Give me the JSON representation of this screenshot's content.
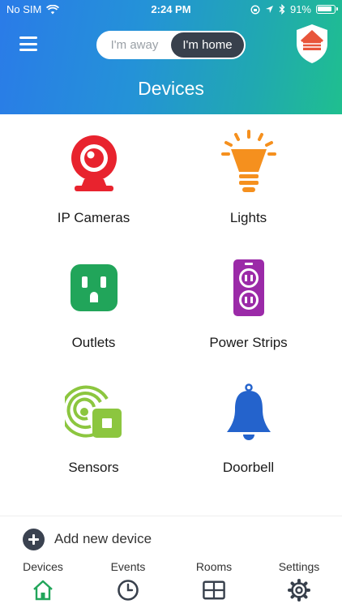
{
  "status_bar": {
    "carrier": "No SIM",
    "time": "2:24 PM",
    "battery": "91%"
  },
  "header": {
    "toggle": {
      "away_label": "I'm away",
      "home_label": "I'm home",
      "selected": "home"
    },
    "title": "Devices"
  },
  "devices": [
    {
      "label": "IP Cameras",
      "icon": "camera-icon",
      "color": "#e8232e"
    },
    {
      "label": "Lights",
      "icon": "lightbulb-icon",
      "color": "#f5901e"
    },
    {
      "label": "Outlets",
      "icon": "outlet-icon",
      "color": "#21a55a"
    },
    {
      "label": "Power Strips",
      "icon": "power-strip-icon",
      "color": "#9b2aa8"
    },
    {
      "label": "Sensors",
      "icon": "sensor-icon",
      "color": "#8cc63f"
    },
    {
      "label": "Doorbell",
      "icon": "bell-icon",
      "color": "#2463cc"
    }
  ],
  "add_device": {
    "label": "Add new device"
  },
  "tabs": [
    {
      "label": "Devices",
      "icon": "home-icon",
      "active": true,
      "color": "#21a55a"
    },
    {
      "label": "Events",
      "icon": "clock-icon",
      "active": false
    },
    {
      "label": "Rooms",
      "icon": "rooms-grid-icon",
      "active": false
    },
    {
      "label": "Settings",
      "icon": "gear-icon",
      "active": false
    }
  ],
  "colors": {
    "accent_dark": "#38404c",
    "gradient_start": "#2a7be8",
    "gradient_end": "#1fbf8f"
  }
}
